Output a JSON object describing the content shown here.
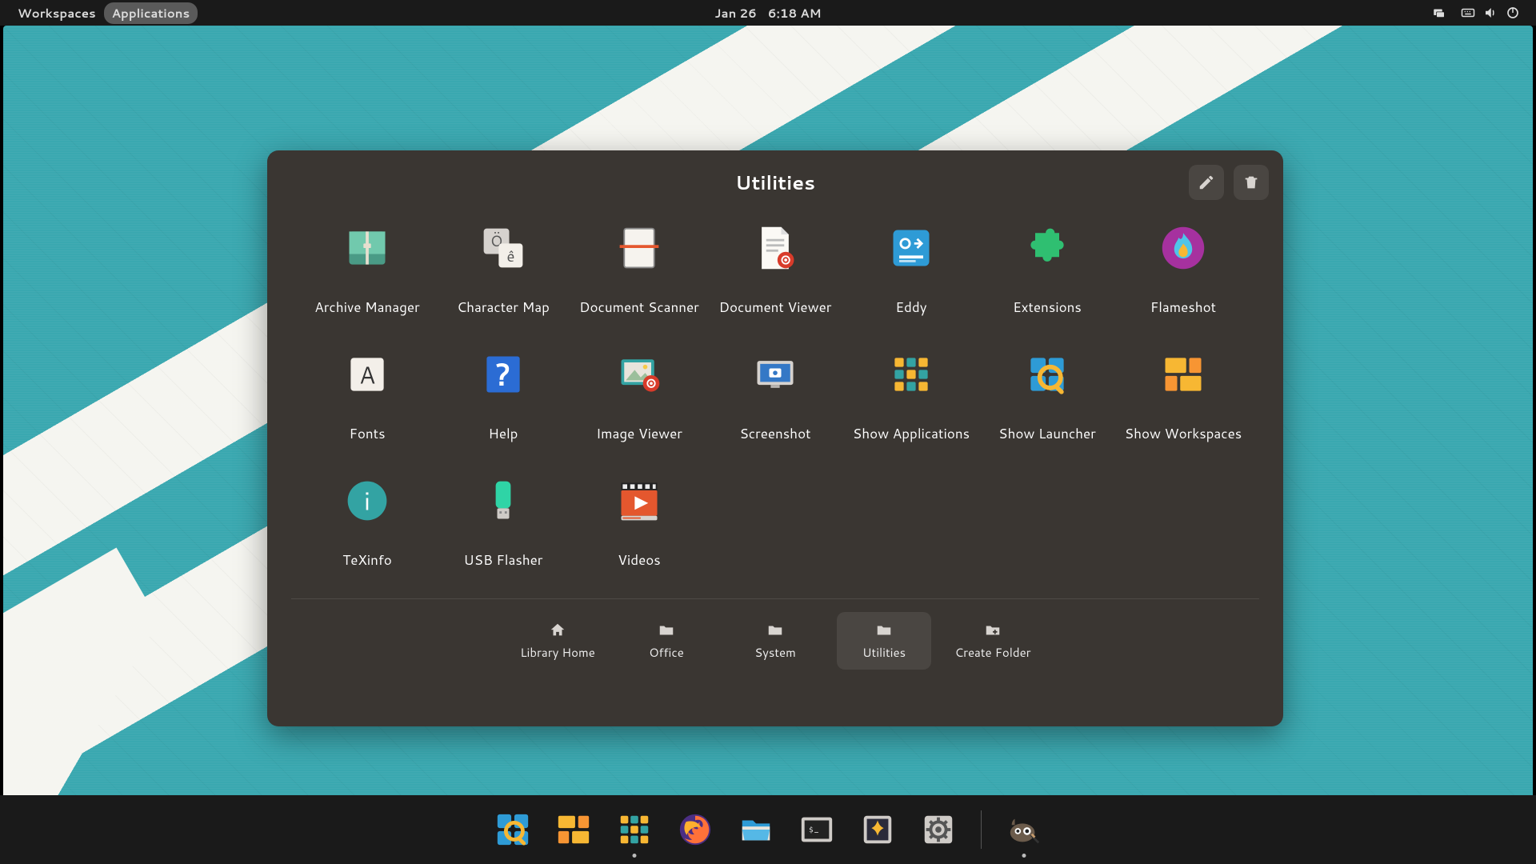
{
  "panel": {
    "workspaces_label": "Workspaces",
    "applications_label": "Applications",
    "date": "Jan 26",
    "time": "6:18 AM"
  },
  "window": {
    "title": "Utilities"
  },
  "apps": [
    {
      "label": "Archive Manager"
    },
    {
      "label": "Character Map"
    },
    {
      "label": "Document Scanner"
    },
    {
      "label": "Document Viewer"
    },
    {
      "label": "Eddy"
    },
    {
      "label": "Extensions"
    },
    {
      "label": "Flameshot"
    },
    {
      "label": "Fonts"
    },
    {
      "label": "Help"
    },
    {
      "label": "Image Viewer"
    },
    {
      "label": "Screenshot"
    },
    {
      "label": "Show Applications"
    },
    {
      "label": "Show Launcher"
    },
    {
      "label": "Show Workspaces"
    },
    {
      "label": "TeXinfo"
    },
    {
      "label": "USB Flasher"
    },
    {
      "label": "Videos"
    }
  ],
  "folders": [
    {
      "label": "Library Home"
    },
    {
      "label": "Office"
    },
    {
      "label": "System"
    },
    {
      "label": "Utilities"
    },
    {
      "label": "Create Folder"
    }
  ],
  "dock": [
    {
      "name": "launcher"
    },
    {
      "name": "workspaces"
    },
    {
      "name": "applications",
      "running": true
    },
    {
      "name": "firefox"
    },
    {
      "name": "files"
    },
    {
      "name": "terminal"
    },
    {
      "name": "celluloid"
    },
    {
      "name": "settings"
    },
    {
      "name": "gimp",
      "running": true
    }
  ]
}
